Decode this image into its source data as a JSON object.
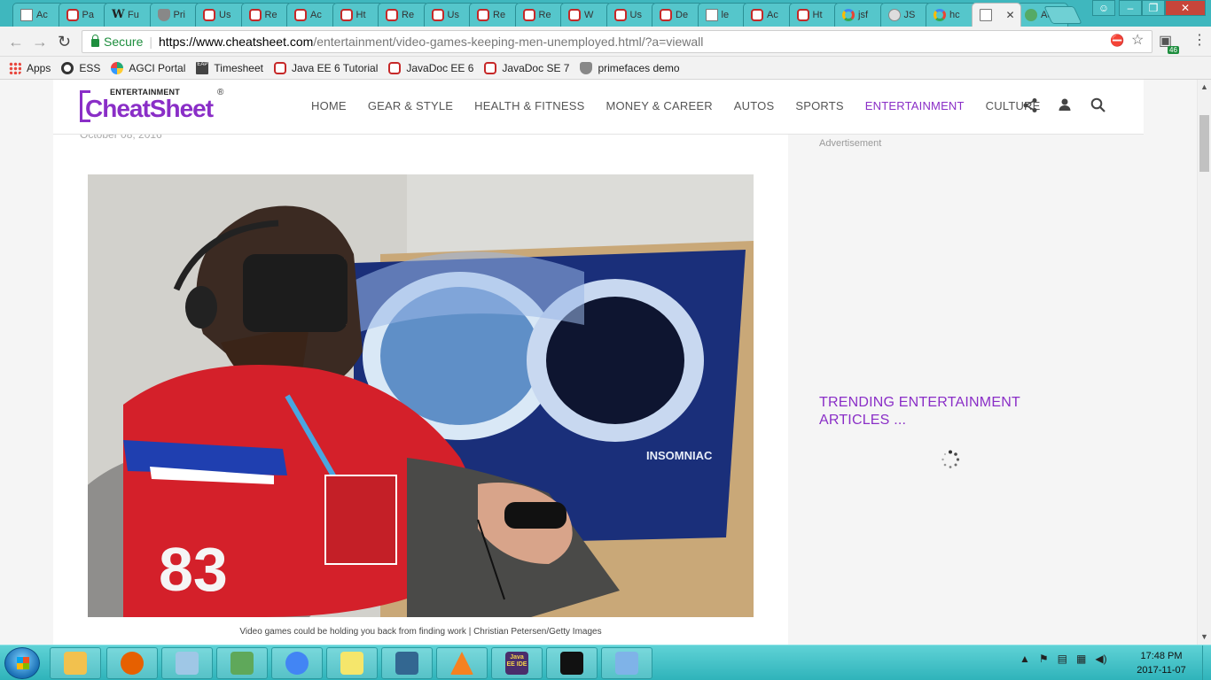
{
  "browser": {
    "tabs": [
      {
        "label": "Ac",
        "icon": "doc"
      },
      {
        "label": "Pa",
        "icon": "red"
      },
      {
        "label": "Fu",
        "icon": "w"
      },
      {
        "label": "Pri",
        "icon": "shield"
      },
      {
        "label": "Us",
        "icon": "red"
      },
      {
        "label": "Re",
        "icon": "red"
      },
      {
        "label": "Ac",
        "icon": "red"
      },
      {
        "label": "Ht",
        "icon": "red"
      },
      {
        "label": "Re",
        "icon": "red"
      },
      {
        "label": "Us",
        "icon": "red"
      },
      {
        "label": "Re",
        "icon": "red"
      },
      {
        "label": "Re",
        "icon": "red"
      },
      {
        "label": "W",
        "icon": "red"
      },
      {
        "label": "Us",
        "icon": "red"
      },
      {
        "label": "De",
        "icon": "red"
      },
      {
        "label": "le",
        "icon": "doc"
      },
      {
        "label": "Ac",
        "icon": "red"
      },
      {
        "label": "Ht",
        "icon": "red"
      },
      {
        "label": "jsf",
        "icon": "g"
      },
      {
        "label": "JS",
        "icon": "q"
      },
      {
        "label": "hc",
        "icon": "g"
      },
      {
        "label": "",
        "icon": "cs",
        "active": true
      },
      {
        "label": "Ac",
        "icon": "bino"
      }
    ],
    "secure_label": "Secure",
    "url_host": "https://www.cheatsheet.com",
    "url_path": "/entertainment/video-games-keeping-men-unemployed.html/?a=viewall",
    "extension_badge": "46",
    "bookmarks": [
      {
        "label": "Apps",
        "icon": "grid"
      },
      {
        "label": "ESS",
        "icon": "ess"
      },
      {
        "label": "AGCI Portal",
        "icon": "agci"
      },
      {
        "label": "Timesheet",
        "icon": "eap"
      },
      {
        "label": "Java EE 6 Tutorial",
        "icon": "red"
      },
      {
        "label": "JavaDoc EE 6",
        "icon": "red"
      },
      {
        "label": "JavaDoc SE 7",
        "icon": "red"
      },
      {
        "label": "primefaces demo",
        "icon": "shield"
      }
    ]
  },
  "site": {
    "logo_top": "ENTERTAINMENT",
    "logo_name": "CheatSheet",
    "logo_reg": "®",
    "nav": [
      {
        "label": "HOME",
        "active": false
      },
      {
        "label": "GEAR & STYLE",
        "active": false
      },
      {
        "label": "HEALTH & FITNESS",
        "active": false
      },
      {
        "label": "MONEY & CAREER",
        "active": false
      },
      {
        "label": "AUTOS",
        "active": false
      },
      {
        "label": "SPORTS",
        "active": false
      },
      {
        "label": "ENTERTAINMENT",
        "active": true
      },
      {
        "label": "CULTURE",
        "active": false
      }
    ],
    "accent": "#8a2ec7"
  },
  "article": {
    "date": "October 08, 2016",
    "caption": "Video games could be holding you back from finding work | Christian Petersen/Getty Images",
    "poster_brand": "INSOMNIAC",
    "jersey_number": "83"
  },
  "sidebar": {
    "ad_label": "Advertisement",
    "trending_heading": "TRENDING ENTERTAINMENT ARTICLES ..."
  },
  "taskbar": {
    "time": "17:48 PM",
    "date": "2017-11-07",
    "apps": [
      "explorer",
      "firefox",
      "notepad",
      "sheet",
      "chrome",
      "sticky-notes",
      "pgadmin",
      "vlc",
      "java-ee-ide",
      "inkscape",
      "paint"
    ],
    "java_ide_label": "Java EE IDE"
  }
}
